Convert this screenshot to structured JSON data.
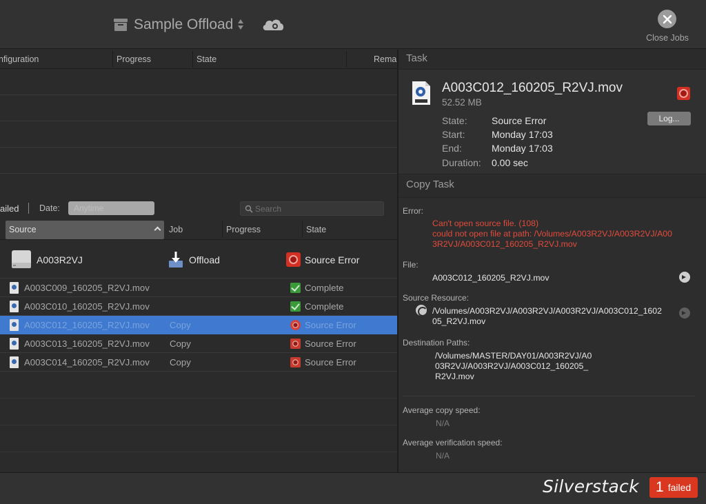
{
  "toolbar": {
    "project_name": "Sample Offload",
    "close_label": "Close Jobs"
  },
  "jobs_table": {
    "columns": [
      "nfiguration",
      "Progress",
      "State",
      "Rema"
    ]
  },
  "filter": {
    "failed_label": "ailed",
    "date_label": "Date:",
    "date_value": "Anytime",
    "search_placeholder": "Search"
  },
  "tasks_table": {
    "columns": {
      "source": "Source",
      "job": "Job",
      "progress": "Progress",
      "state": "State"
    },
    "group": {
      "name": "A003R2VJ",
      "job": "Offload",
      "state": "Source Error"
    },
    "rows": [
      {
        "name": "A003C009_160205_R2VJ.mov",
        "job": "",
        "state": "Complete",
        "status": "complete"
      },
      {
        "name": "A003C010_160205_R2VJ.mov",
        "job": "",
        "state": "Complete",
        "status": "complete"
      },
      {
        "name": "A003C012_160205_R2VJ.mov",
        "job": "Copy",
        "state": "Source Error",
        "status": "error",
        "selected": true
      },
      {
        "name": "A003C013_160205_R2VJ.mov",
        "job": "Copy",
        "state": "Source Error",
        "status": "error"
      },
      {
        "name": "A003C014_160205_R2VJ.mov",
        "job": "Copy",
        "state": "Source Error",
        "status": "error"
      }
    ]
  },
  "task_panel": {
    "section_title": "Task",
    "file_name": "A003C012_160205_R2VJ.mov",
    "file_size": "52.52 MB",
    "log_button": "Log...",
    "details": [
      {
        "key": "State:",
        "value": "Source Error"
      },
      {
        "key": "Start:",
        "value": "Monday 17:03"
      },
      {
        "key": "End:",
        "value": "Monday 17:03"
      },
      {
        "key": "Duration:",
        "value": "0.00 sec"
      }
    ]
  },
  "copy_task": {
    "section_title": "Copy Task",
    "error_label": "Error:",
    "error_lines": [
      "Can't open source file. (108)",
      "could not open file at path: /Volumes/A003R2VJ/A003R2VJ/A00",
      "3R2VJ/A003C012_160205_R2VJ.mov"
    ],
    "file_label": "File:",
    "file_value": "A003C012_160205_R2VJ.mov",
    "source_resource_label": "Source Resource:",
    "source_resource_lines": [
      "/Volumes/A003R2VJ/A003R2VJ/A003R2VJ/A003C012_1602",
      "05_R2VJ.mov"
    ],
    "destination_label": "Destination Paths:",
    "destination_lines": [
      "/Volumes/MASTER/DAY01/A003R2VJ/A0",
      "03R2VJ/A003R2VJ/A003C012_160205_",
      "R2VJ.mov"
    ],
    "avg_copy_label": "Average copy speed:",
    "avg_copy_value": "N/A",
    "avg_verify_label": "Average verification speed:",
    "avg_verify_value": "N/A"
  },
  "footer": {
    "brand": "Silverstack",
    "failed_count": "1",
    "failed_text": "failed"
  },
  "colors": {
    "accent_selection": "#3f7ad0",
    "error_red": "#d42f23",
    "complete_green": "#3a9a3a",
    "error_text": "#e34b3c"
  }
}
